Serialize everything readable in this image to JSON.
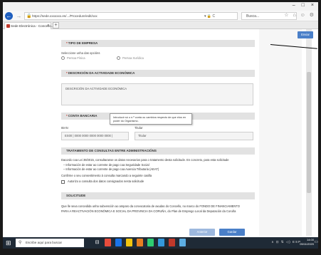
{
  "browser": {
    "window_controls": [
      "–",
      "□",
      "×"
    ],
    "url": "https://sede.xxxxxxx.es/.../Procedure/edit/xxx",
    "url_tools": "▾ 🔒 C",
    "search_placeholder": "Busca...",
    "toolbar_icons": "☆ ⌂ ☺ ⚙",
    "tab_title": "Sede Electrónica - Concello...",
    "tab_close": "×",
    "new_tab": "+"
  },
  "page": {
    "send_button": "Enviar",
    "empresa": {
      "title": "TIPO DE EMPRESA",
      "required_mark": "*",
      "prompt": "Seleccione unha das opcións",
      "options": [
        "Persoa Física",
        "Persoa Xurídica"
      ]
    },
    "actividade": {
      "title": "DESCRICIÓN DA ACTIVIDADE ECONÓMICA",
      "required_mark": "*",
      "value": "DESCRICIÓN DA ACTIVIDADE ECONÓMICA"
    },
    "conta": {
      "title": "CONTA BANCARIA",
      "required_mark": "*",
      "tooltip": "Introducir só o n.º conta ou cambios respecto de que elos en poder do Organismo.",
      "iban_label": "IBAN",
      "iban_value": "ES00 | 0000 0000 0000 0000 0000 |",
      "titular_label": "Titular",
      "titular_value": "Titular"
    },
    "consultas": {
      "title": "TRATAMENTO DE CONSULTAS ENTRE ADMINISTRACIÓNS",
      "intro": "Dacordo coa Lei 39/2015, consultaranse os datos necesarios para o tratamento desta solicitude. En concreto, para esta solicitude",
      "items": [
        "– Información de estar ao corrente de pago coa Seguridade Social",
        "– Información de estar ao corrente de pago coa Axencia Tributaria (AEAT)"
      ],
      "confirm": "Confirme o seu consentimento á consulta marcando a seguinte casilla",
      "checkbox_label": "Autorizo a consulta dos datos consignados nesta solicitude"
    },
    "solicitude": {
      "title": "SOLICITUDE",
      "text_line1": "Que lle sexa concedida unha subvención ao amparo da convocatoria de axudas do Concello, no marco do FONDO DE FINANCIAMENTO",
      "text_line2": "PARA A REACTIVACIÓN ECONÓMICA E SOCIAL DA PROVINCIA DA CORUÑA, do Plan de Emprego Local da Deputación da Coruña"
    },
    "footer_buttons": [
      "Anterior",
      "Gardar"
    ]
  },
  "taskbar": {
    "start_icon": "⊞",
    "search_placeholder": "Escribe aquí para buscar",
    "tray": "∧ ⊡ ⇅ ◁) ESP",
    "time": "14:00",
    "date": "05/11/2020",
    "notifications": "▭"
  },
  "colors": {
    "accent_blue": "#4a7fc8",
    "section_header": "#e2e2e2",
    "taskbar": "#1f2a36"
  }
}
